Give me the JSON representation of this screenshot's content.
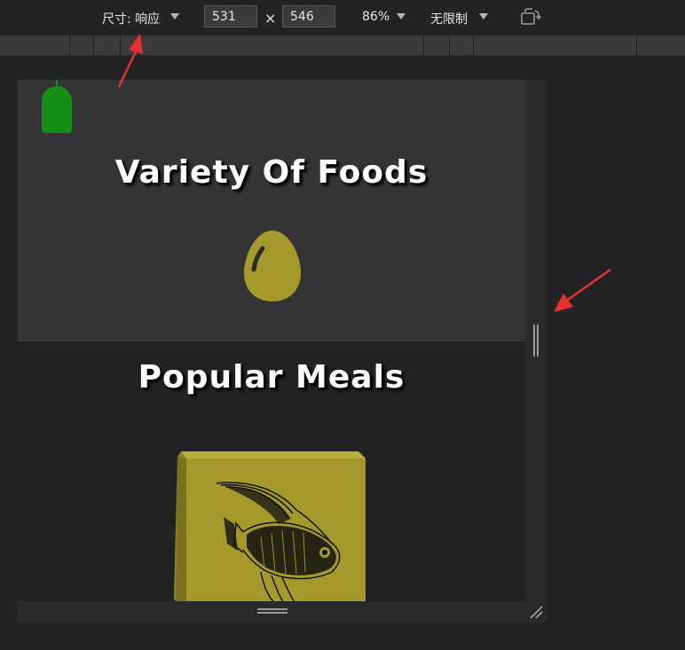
{
  "toolbar": {
    "dimensions_label": "尺寸: 响应",
    "width_value": "531",
    "times_symbol": "×",
    "height_value": "546",
    "zoom_label": "86%",
    "throttle_label": "无限制",
    "rotate_icon": "rotate-device-icon"
  },
  "page": {
    "section1_title": "Variety Of Foods",
    "section2_title": "Popular Meals",
    "badge_icon": "green-badge-icon",
    "egg_icon": "egg-icon",
    "fish_icon": "fish-illustration-icon"
  },
  "colors": {
    "toolbar_bg": "#232325",
    "section1_bg": "#343436",
    "section2_bg": "#222224",
    "badge": "#149114",
    "olive": "#a49a2c",
    "arrow": "#e8312e"
  }
}
